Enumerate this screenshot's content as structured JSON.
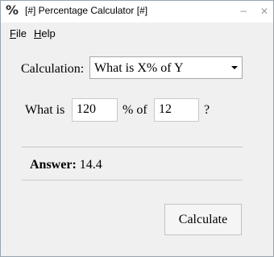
{
  "window": {
    "app_icon": "%",
    "title": "[#] Percentage Calculator [#]",
    "minimize_glyph": "−",
    "close_glyph": "✕"
  },
  "menu": {
    "file": {
      "label": "File",
      "underline": "F",
      "rest": "ile"
    },
    "help": {
      "label": "Help",
      "underline": "H",
      "rest": "elp"
    }
  },
  "form": {
    "calculation_label": "Calculation:",
    "calculation_value": "What is X% of Y",
    "what_is_label": "What is",
    "x_value": "120",
    "percent_of_label": "% of",
    "y_value": "12",
    "question_mark": "?"
  },
  "result": {
    "answer_label": "Answer:",
    "answer_value": "14.4"
  },
  "buttons": {
    "calculate_label": "Calculate"
  }
}
